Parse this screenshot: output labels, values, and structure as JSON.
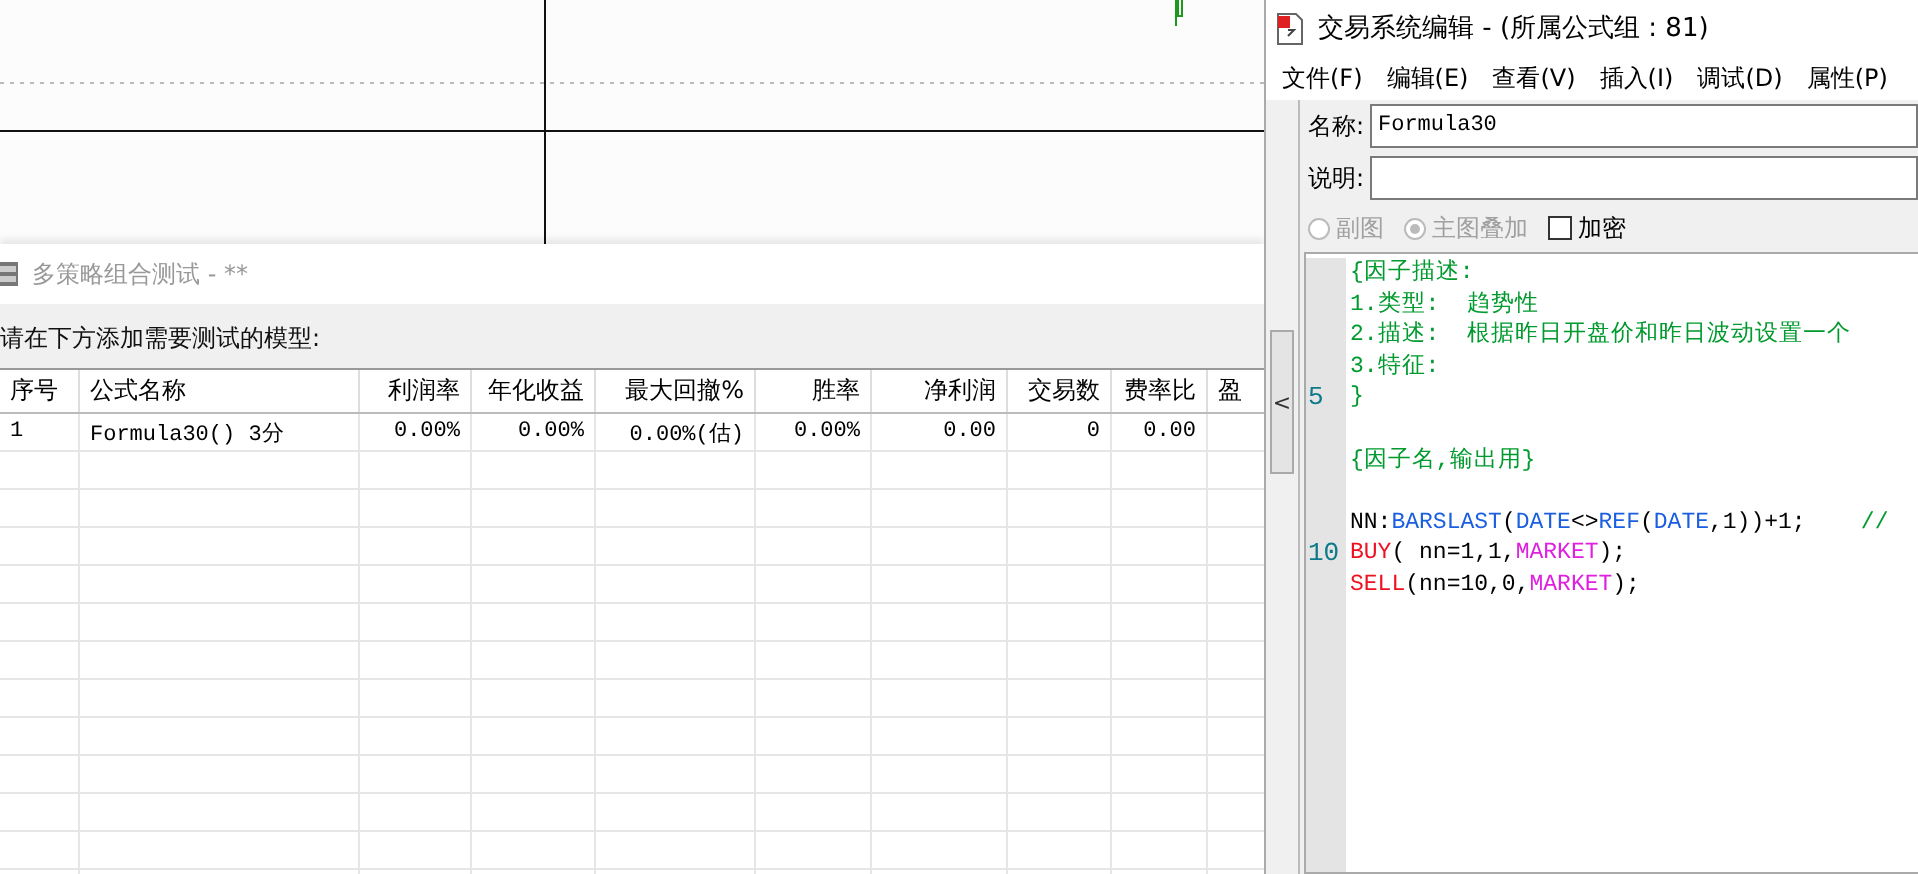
{
  "strategy_window": {
    "title": "多策略组合测试 -  **",
    "prompt": "请在下方添加需要测试的模型:",
    "table": {
      "columns": [
        "序号",
        "公式名称",
        "利润率",
        "年化收益",
        "最大回撤%",
        "胜率",
        "净利润",
        "交易数",
        "费率比",
        "盈"
      ],
      "rows": [
        [
          "1",
          "Formula30() 3分",
          "0.00%",
          "0.00%",
          "0.00%(估)",
          "0.00%",
          "0.00",
          "0",
          "0.00",
          ""
        ]
      ]
    }
  },
  "editor_window": {
    "title": "交易系统编辑 - (所属公式组 : 81)",
    "menu": [
      "文件(F)",
      "编辑(E)",
      "查看(V)",
      "插入(I)",
      "调试(D)",
      "属性(P)"
    ],
    "name_label": "名称:",
    "name_value": "Formula30",
    "desc_label": "说明:",
    "options": [
      {
        "kind": "radio",
        "label": "副图",
        "selected": false,
        "disabled": true
      },
      {
        "kind": "radio",
        "label": "主图叠加",
        "selected": true,
        "disabled": true
      },
      {
        "kind": "checkbox",
        "label": "加密",
        "checked": false
      }
    ],
    "collapse_button": "<",
    "code": [
      {
        "tokens": [
          {
            "kind": "comment",
            "text": "{因子描述:"
          }
        ]
      },
      {
        "tokens": [
          {
            "kind": "comment",
            "text": "1.类型:  趋势性"
          }
        ]
      },
      {
        "tokens": [
          {
            "kind": "comment",
            "text": "2.描述:  根据昨日开盘价和昨日波动设置一个"
          }
        ]
      },
      {
        "tokens": [
          {
            "kind": "comment",
            "text": "3.特征:"
          }
        ]
      },
      {
        "number": "5",
        "tokens": [
          {
            "kind": "comment",
            "text": "}"
          }
        ]
      },
      {
        "kind": "blank"
      },
      {
        "tokens": [
          {
            "kind": "comment",
            "text": "{因子名,输出用}"
          }
        ]
      },
      {
        "kind": "blank"
      },
      {
        "tokens": [
          {
            "kind": "plain",
            "text": "NN:"
          },
          {
            "kind": "function",
            "text": "BARSLAST"
          },
          {
            "kind": "plain",
            "text": "("
          },
          {
            "kind": "function",
            "text": "DATE"
          },
          {
            "kind": "plain",
            "text": "<>"
          },
          {
            "kind": "function",
            "text": "REF"
          },
          {
            "kind": "plain",
            "text": "("
          },
          {
            "kind": "function",
            "text": "DATE"
          },
          {
            "kind": "plain",
            "text": ",1))+1;    "
          },
          {
            "kind": "comment",
            "text": "//"
          }
        ]
      },
      {
        "number": "10",
        "tokens": [
          {
            "kind": "order",
            "text": "BUY"
          },
          {
            "kind": "plain",
            "text": "( nn=1,1,"
          },
          {
            "kind": "constant",
            "text": "MARKET"
          },
          {
            "kind": "plain",
            "text": ");"
          }
        ]
      },
      {
        "tokens": [
          {
            "kind": "order",
            "text": "SELL"
          },
          {
            "kind": "plain",
            "text": "(nn=10,0,"
          },
          {
            "kind": "constant",
            "text": "MARKET"
          },
          {
            "kind": "plain",
            "text": ");"
          }
        ]
      }
    ]
  }
}
